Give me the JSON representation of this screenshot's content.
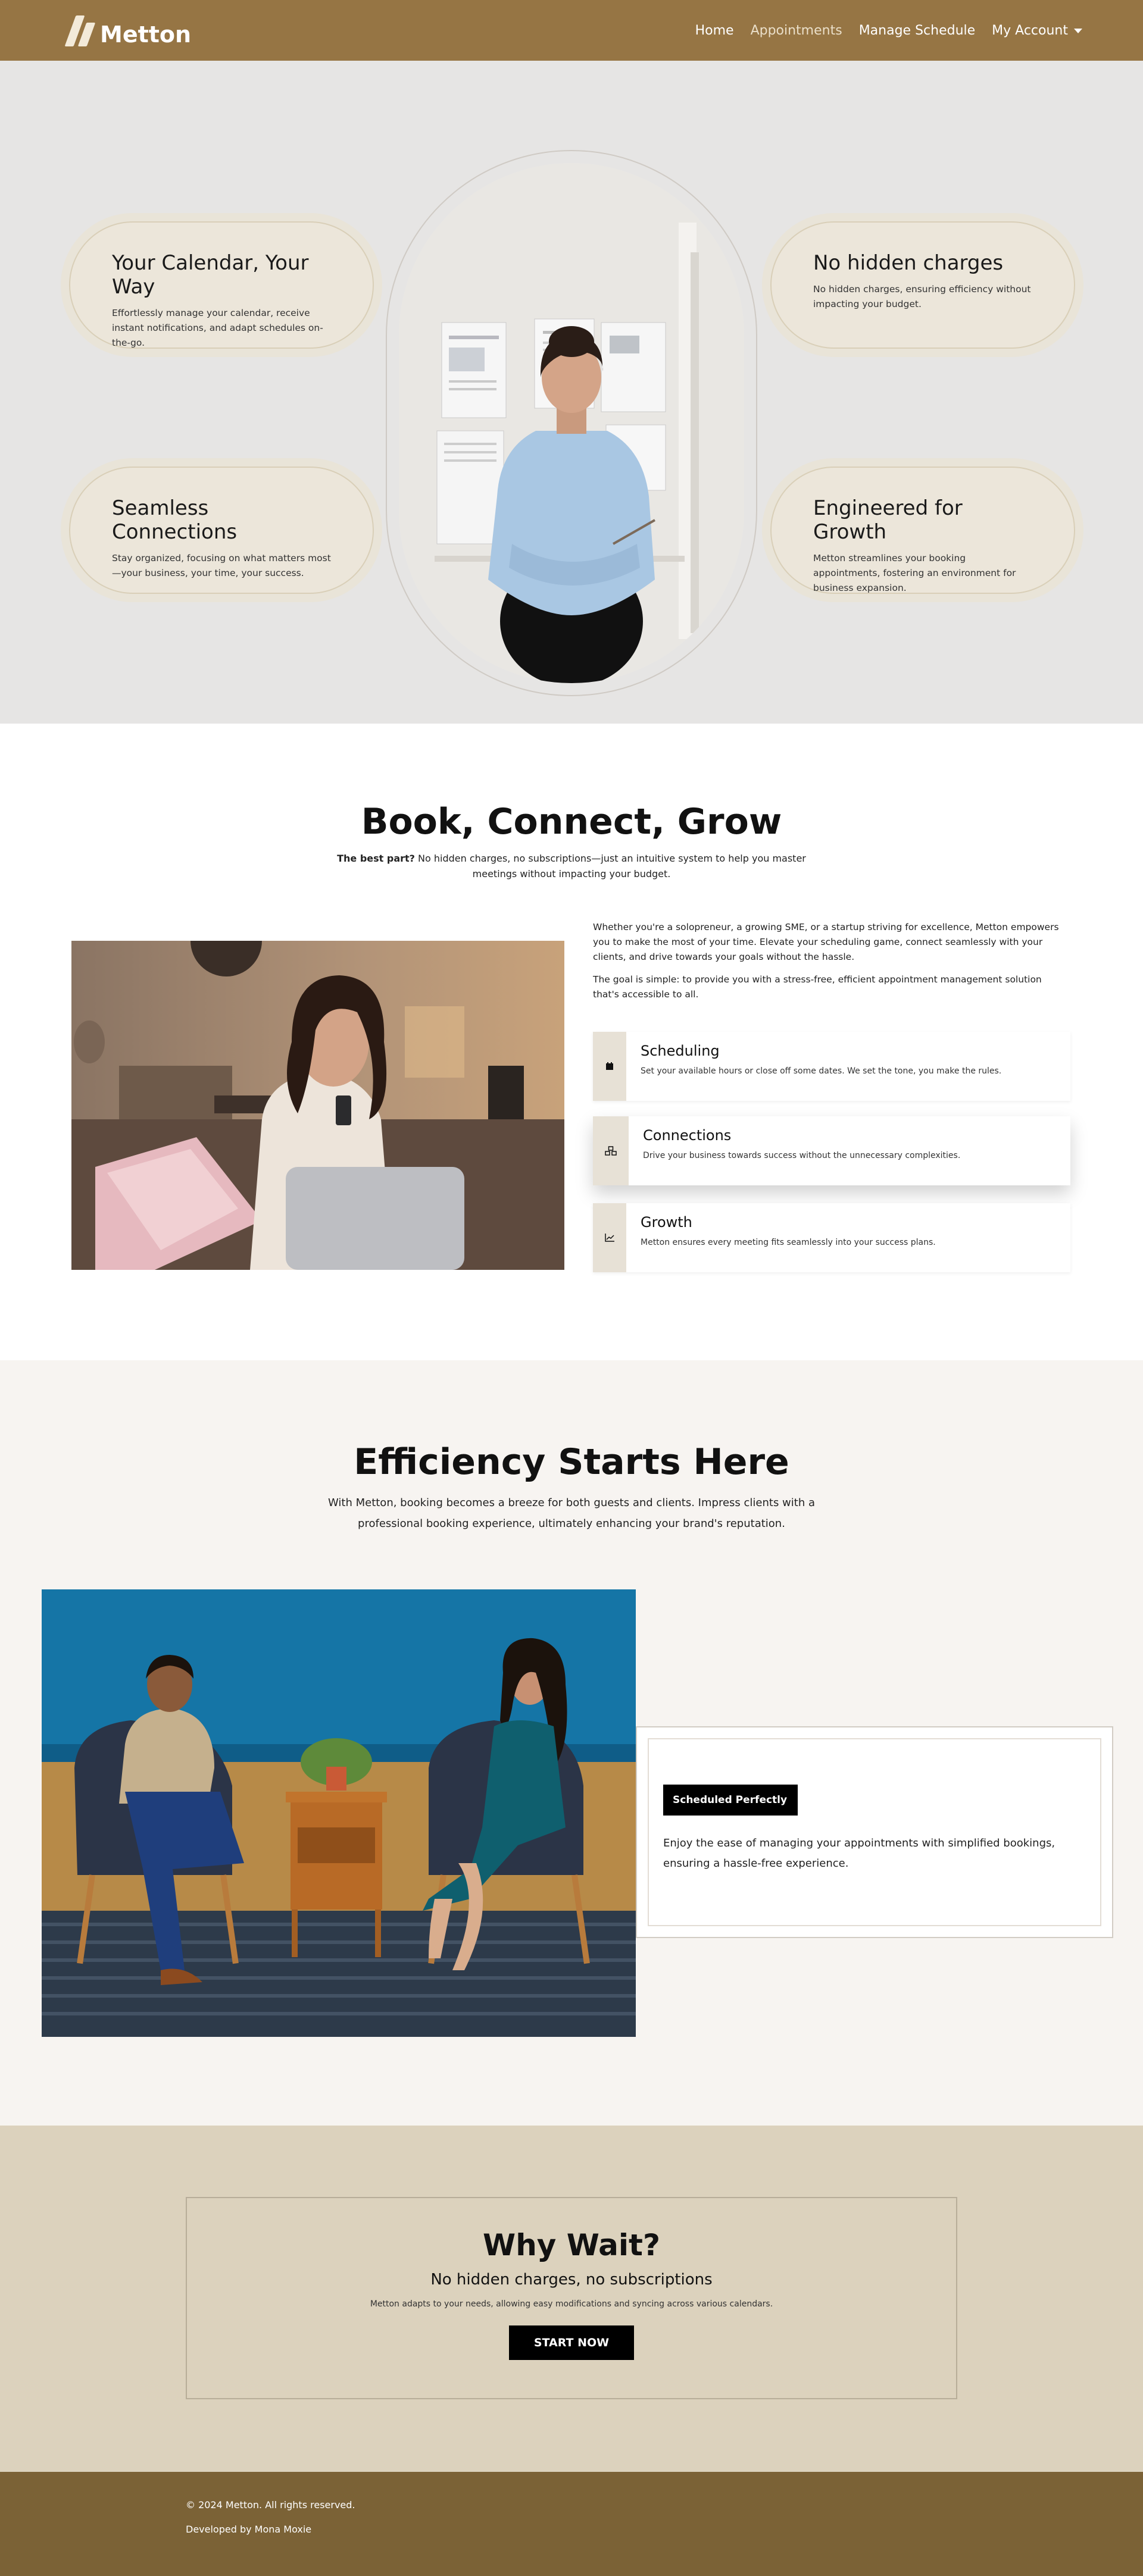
{
  "nav": {
    "brand": "Metton",
    "links": [
      {
        "label": "Home"
      },
      {
        "label": "Appointments"
      },
      {
        "label": "Manage Schedule"
      },
      {
        "label": "My Account"
      }
    ]
  },
  "hero": {
    "features": [
      {
        "title": "Your Calendar, Your Way",
        "text": "Effortlessly manage your calendar, receive instant notifications, and adapt schedules on-the-go."
      },
      {
        "title": "No hidden charges",
        "text": "No hidden charges, ensuring efficiency without impacting your budget."
      },
      {
        "title": "Seamless Connections",
        "text": "Stay organized, focusing on what matters most—your business, your time, your success."
      },
      {
        "title": "Engineered for Growth",
        "text": "Metton streamlines your booking appointments, fostering an environment for business expansion."
      }
    ]
  },
  "book": {
    "title": "Book, Connect, Grow",
    "sub_bold": "The best part?",
    "sub_text": " No hidden charges, no subscriptions—just an intuitive system to help you master meetings without impacting your budget.",
    "para1": "Whether you're a solopreneur, a growing SME, or a startup striving for excellence, Metton empowers you to make the most of your time. Elevate your scheduling game, connect seamlessly with your clients, and drive towards your goals without the hassle.",
    "para2": "The goal is simple: to provide you with a stress-free, efficient appointment management solution that's accessible to all.",
    "cards": [
      {
        "title": "Scheduling",
        "text": "Set your available hours or close off some dates. We set the tone, you make the rules.",
        "icon": "calendar-icon"
      },
      {
        "title": "Connections",
        "text": "Drive your business towards success without the unnecessary complexities.",
        "icon": "people-icon"
      },
      {
        "title": "Growth",
        "text": "Metton ensures every meeting fits seamlessly into your success plans.",
        "icon": "chart-icon"
      }
    ]
  },
  "efficiency": {
    "title": "Efficiency Starts Here",
    "lead": "With Metton, booking becomes a breeze for both guests and clients. Impress clients with a professional booking experience, ultimately enhancing your brand's reputation.",
    "badge": "Scheduled Perfectly",
    "text": "Enjoy the ease of managing your appointments with simplified bookings, ensuring a hassle-free experience."
  },
  "why": {
    "title": "Why Wait?",
    "subtitle": "No hidden charges, no subscriptions",
    "text": "Metton adapts to your needs, allowing easy modifications and syncing across various calendars.",
    "cta": "START NOW"
  },
  "footer": {
    "copyright": "© 2024 Metton. All rights reserved.",
    "credit": "Developed by Mona Moxie"
  },
  "colors": {
    "nav_bg": "#967544",
    "footer_bg": "#7b6236",
    "why_bg": "#dcd2bd",
    "efficiency_bg": "#f7f4f1"
  }
}
